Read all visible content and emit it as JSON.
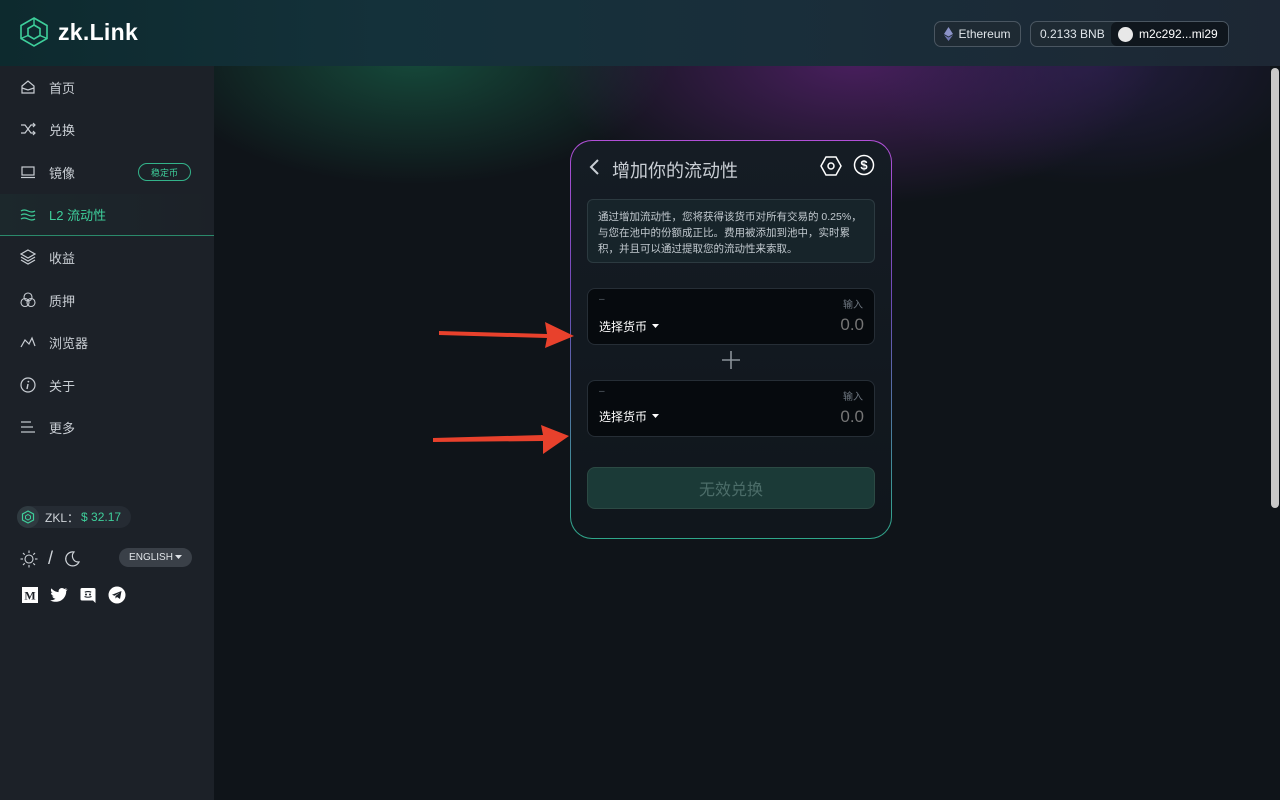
{
  "brand": {
    "name": "zk.Link"
  },
  "header": {
    "network_label": "Ethereum",
    "balance": "0.2133 BNB",
    "address": "m2c292...mi29"
  },
  "sidebar": {
    "items": [
      {
        "label": "首页",
        "icon": "home-icon"
      },
      {
        "label": "兑换",
        "icon": "shuffle-icon"
      },
      {
        "label": "镜像",
        "icon": "laptop-icon"
      },
      {
        "label": "L2 流动性",
        "icon": "waves-icon",
        "active": true
      },
      {
        "label": "收益",
        "icon": "layers-icon"
      },
      {
        "label": "质押",
        "icon": "circles-icon"
      },
      {
        "label": "浏览器",
        "icon": "chart-line-icon"
      },
      {
        "label": "关于",
        "icon": "info-icon"
      },
      {
        "label": "更多",
        "icon": "menu-icon"
      }
    ],
    "mirror_tag": "稳定币",
    "zkl_label": "ZKL：",
    "zkl_price": "$ 32.17",
    "theme_divider": "/",
    "language": "ENGLISH"
  },
  "card": {
    "title": "增加你的流动性",
    "info": "通过增加流动性，您将获得该货币对所有交易的 0.25%，与您在池中的份额成正比。费用被添加到池中，实时累积，并且可以通过提取您的流动性来索取。",
    "token_a": {
      "top_label": "–",
      "input_label": "输入",
      "select_label": "选择货币",
      "amount": "0.0"
    },
    "token_b": {
      "top_label": "–",
      "input_label": "输入",
      "select_label": "选择货币",
      "amount": "0.0"
    },
    "submit_label": "无效兑换"
  },
  "colors": {
    "accent": "#3ecf9b",
    "annotation_arrow": "#e8412c",
    "card_border_top": "#b04fd6",
    "card_border_bottom": "#2fa78a"
  }
}
